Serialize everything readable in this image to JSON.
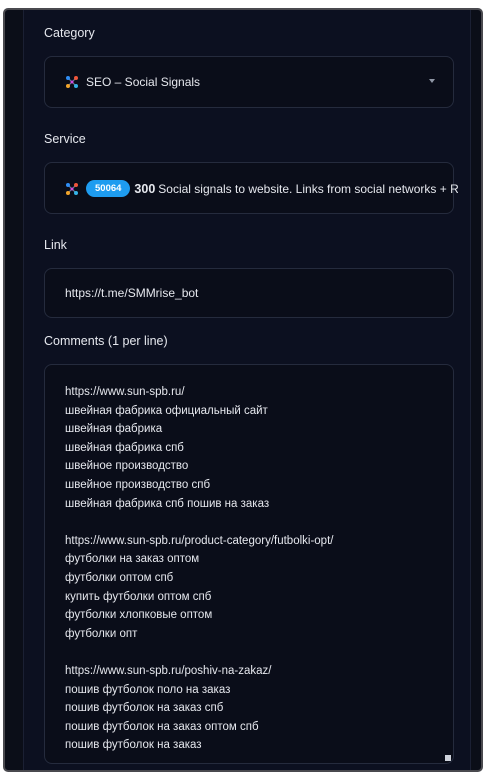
{
  "form": {
    "category_label": "Category",
    "category_value": "SEO – Social Signals",
    "service_label": "Service",
    "service_id": "50064",
    "service_count": "300",
    "service_text": "Social signals to website. Links from social networks + Re",
    "link_label": "Link",
    "link_value": "https://t.me/SMMrise_bot",
    "comments_label": "Comments (1 per line)",
    "comments_lines": [
      "https://www.sun-spb.ru/",
      "швейная фабрика официальный сайт",
      "швейная фабрика",
      "швейная фабрика спб",
      "швейное производство",
      "швейное производство спб",
      "швейная фабрика спб пошив на заказ",
      "",
      "https://www.sun-spb.ru/product-category/futbolki-opt/",
      "футболки на заказ оптом",
      "футболки оптом спб",
      "купить футболки оптом спб",
      "футболки хлопковые оптом",
      "футболки опт",
      "",
      "https://www.sun-spb.ru/poshiv-na-zakaz/",
      "пошив футболок поло на заказ",
      "пошив футболок на заказ спб",
      "пошив футболок на заказ оптом спб",
      "пошив футболок на заказ"
    ]
  },
  "colors": {
    "background": "#0c1020",
    "accent": "#1e9cf0",
    "text": "#e6e8ee"
  },
  "icons": {
    "category": "social-network-icon",
    "service": "social-network-icon",
    "dropdown": "chevron-down-icon"
  }
}
